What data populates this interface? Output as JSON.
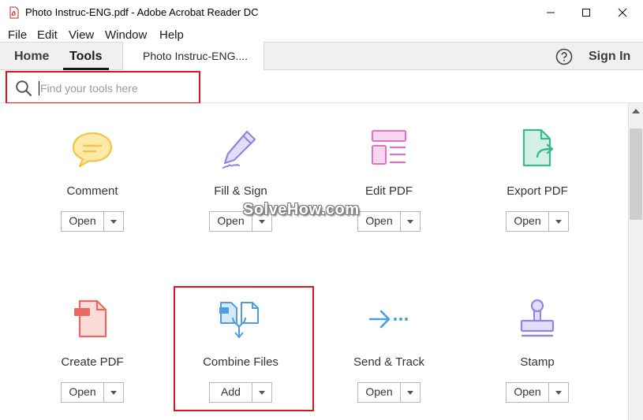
{
  "window": {
    "title": "Photo Instruc-ENG.pdf - Adobe Acrobat Reader DC",
    "app_icon": "pdf-file-icon",
    "controls": {
      "minimize": "minimize-icon",
      "maximize": "maximize-icon",
      "close": "close-icon"
    }
  },
  "menu": {
    "file": "File",
    "edit": "Edit",
    "view": "View",
    "window": "Window",
    "help": "Help"
  },
  "tabs": {
    "home": "Home",
    "tools": "Tools",
    "document": "Photo Instruc-ENG....",
    "sign_in": "Sign In",
    "help_icon": "question-circle-icon"
  },
  "search": {
    "placeholder": "Find your tools here",
    "value": "",
    "icon": "search-icon"
  },
  "tools": [
    {
      "label": "Comment",
      "button": "Open",
      "icon": "speech-bubble-icon",
      "color": "#f5c443"
    },
    {
      "label": "Fill & Sign",
      "button": "Open",
      "icon": "pen-sign-icon",
      "color": "#8f86e0"
    },
    {
      "label": "Edit PDF",
      "button": "Open",
      "icon": "edit-layout-icon",
      "color": "#e46fc7"
    },
    {
      "label": "Export PDF",
      "button": "Open",
      "icon": "export-file-icon",
      "color": "#3ab88f"
    },
    {
      "label": "Create PDF",
      "button": "Open",
      "icon": "create-pdf-icon",
      "color": "#ea6a62"
    },
    {
      "label": "Combine Files",
      "button": "Add",
      "icon": "combine-files-icon",
      "color": "#4b9fdc"
    },
    {
      "label": "Send & Track",
      "button": "Open",
      "icon": "send-track-icon",
      "color": "#4b9fdc"
    },
    {
      "label": "Stamp",
      "button": "Open",
      "icon": "stamp-icon",
      "color": "#8f86e0"
    }
  ],
  "watermark": "SolveHow.com",
  "colors": {
    "highlight": "#e0141e",
    "tabbar": "#f0f0f0"
  }
}
